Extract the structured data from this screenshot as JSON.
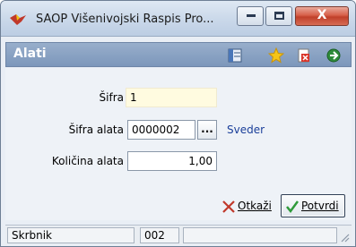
{
  "window": {
    "title": "SAOP  Višenivojski Raspis Pro...",
    "icons": {
      "app": "bird-logo-icon",
      "minimize": "minimize-icon",
      "maximize": "maximize-icon",
      "close": "close-icon"
    },
    "close_glyph": "X"
  },
  "header": {
    "title": "Alati",
    "toolbar_icons": [
      "layout-icon",
      "favorite-star-icon",
      "document-delete-icon",
      "exit-icon"
    ]
  },
  "form": {
    "sifra": {
      "label": "Šifra",
      "value": "1"
    },
    "sifra_alata": {
      "label": "Šifra alata",
      "value": "0000002",
      "browse_label": "...",
      "description": "Sveder"
    },
    "kolicina_alata": {
      "label": "Količina alata",
      "value": "1,00"
    }
  },
  "buttons": {
    "cancel": {
      "label": "Otkaži",
      "icon": "red-x-icon"
    },
    "confirm": {
      "label": "Potvrdi",
      "icon": "green-checkmark-icon"
    }
  },
  "statusbar": {
    "label": "Skrbnik",
    "value": "002"
  },
  "colors": {
    "header_bg": "#7c97bb",
    "link": "#1a3f9a",
    "input_highlight": "#fffbe0",
    "close_button": "#c0402a"
  }
}
